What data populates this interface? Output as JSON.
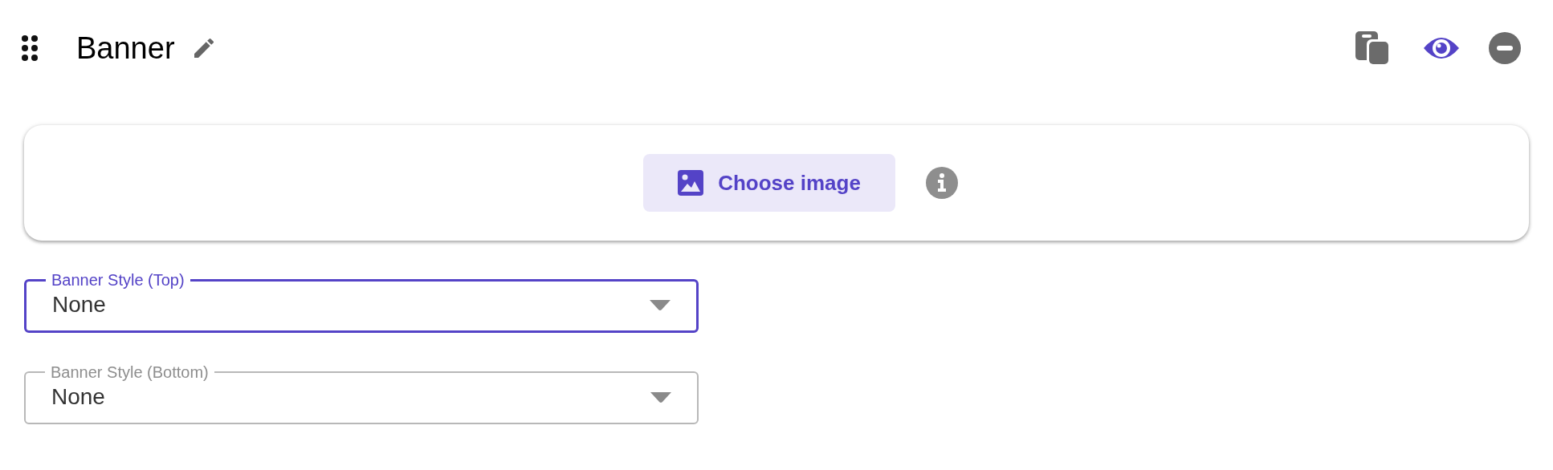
{
  "header": {
    "title": "Banner"
  },
  "image_card": {
    "button": "Choose image"
  },
  "fields": [
    {
      "label": "Banner Style (Top)",
      "value": "None",
      "focused": true
    },
    {
      "label": "Banner Style (Bottom)",
      "value": "None",
      "focused": false
    }
  ]
}
